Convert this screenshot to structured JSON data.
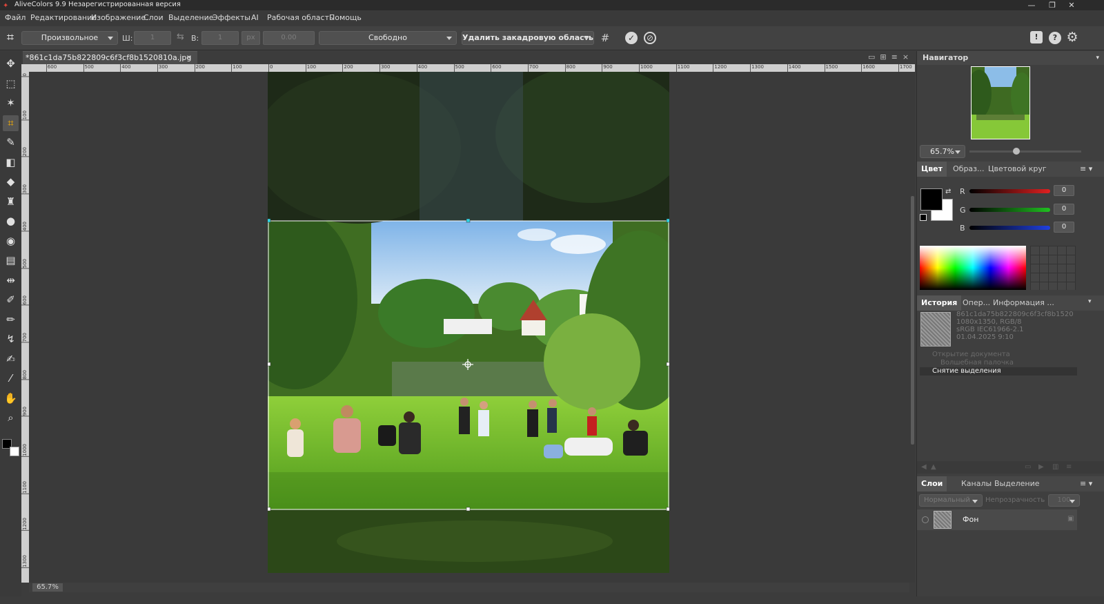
{
  "app": {
    "title": "AliveColors 9.9 Незарегистрированная версия",
    "logo_icon": "alivecolors-logo-icon"
  },
  "window_controls": [
    "minimize-icon",
    "restore-icon",
    "close-icon"
  ],
  "menu": [
    "Файл",
    "Редактирование",
    "Изображение",
    "Слои",
    "Выделение",
    "Эффекты",
    "AI",
    "Рабочая область",
    "Помощь"
  ],
  "options": {
    "preset": "Произвольное",
    "width_label": "Ш:",
    "width_value": "1",
    "height_label": "В:",
    "height_value": "1",
    "unit": "px",
    "angle_value": "0.00",
    "mode": "Свободно",
    "delete_outside": "Удалить закадровую область",
    "accent": "#ffb400"
  },
  "document": {
    "tab_title": "*861c1da75b822809c6f3cf8b1520810a.jpg",
    "zoom": "65.7%"
  },
  "ruler_h": [
    "600",
    "500",
    "400",
    "300",
    "200",
    "100",
    "0",
    "100",
    "200",
    "300",
    "400",
    "500",
    "600",
    "700",
    "800",
    "900",
    "1000",
    "1100",
    "1200",
    "1300",
    "1400",
    "1500",
    "1600",
    "1700"
  ],
  "ruler_v": [
    "0",
    "100",
    "200",
    "300",
    "400",
    "500",
    "600",
    "700",
    "800",
    "900",
    "1000",
    "1100",
    "1200",
    "1300"
  ],
  "navigator": {
    "title": "Навигатор",
    "zoom": "65.7%",
    "zoom_level": 0.42
  },
  "color_panel": {
    "tabs": [
      "Цвет",
      "Образ...",
      "Цветовой круг"
    ],
    "channels": [
      {
        "name": "R",
        "value": "0",
        "color": "#e02020"
      },
      {
        "name": "G",
        "value": "0",
        "color": "#20c020"
      },
      {
        "name": "B",
        "value": "0",
        "color": "#2040e0"
      }
    ],
    "foreground": "#000000",
    "background": "#ffffff"
  },
  "history_panel": {
    "tabs": [
      "История",
      "Опер...",
      "Информация ..."
    ],
    "snapshot": {
      "name": "861c1da75b822809c6f3cf8b1520",
      "size": "1080x1350, RGB/8",
      "profile": "sRGB IEC61966-2.1",
      "date": "01.04.2025 9:10"
    },
    "items": [
      "Открытие документа",
      "Волшебная палочка",
      "Снятие выделения"
    ]
  },
  "layers_panel": {
    "tabs": [
      "Слои",
      "Каналы",
      "Выделение"
    ],
    "blend_mode": "Нормальный",
    "opacity_label": "Непрозрачность",
    "opacity_value": "100",
    "layers": [
      {
        "name": "Фон"
      }
    ]
  },
  "tools": [
    {
      "name": "move-tool-icon",
      "glyph": "✥"
    },
    {
      "name": "rect-select-tool-icon",
      "glyph": "⬚"
    },
    {
      "name": "magic-wand-tool-icon",
      "glyph": "✶"
    },
    {
      "name": "crop-tool-icon",
      "glyph": "⌗"
    },
    {
      "name": "brush-tool-icon",
      "glyph": "✎"
    },
    {
      "name": "eraser-tool-icon",
      "glyph": "◧"
    },
    {
      "name": "fill-tool-icon",
      "glyph": "◆"
    },
    {
      "name": "stamp-tool-icon",
      "glyph": "♜"
    },
    {
      "name": "blur-tool-icon",
      "glyph": "●"
    },
    {
      "name": "smudge-tool-icon",
      "glyph": "◉"
    },
    {
      "name": "ruler-tool-icon",
      "glyph": "▤"
    },
    {
      "name": "symmetry-tool-icon",
      "glyph": "⇹"
    },
    {
      "name": "pen-tool-icon",
      "glyph": "✐"
    },
    {
      "name": "pencil-tool-icon",
      "glyph": "✏"
    },
    {
      "name": "path-tool-icon",
      "glyph": "↯"
    },
    {
      "name": "smart-brush-tool-icon",
      "glyph": "✍"
    },
    {
      "name": "eyedropper-tool-icon",
      "glyph": "⁄"
    },
    {
      "name": "hand-tool-icon",
      "glyph": "✋"
    },
    {
      "name": "zoom-tool-icon",
      "glyph": "⌕"
    }
  ]
}
